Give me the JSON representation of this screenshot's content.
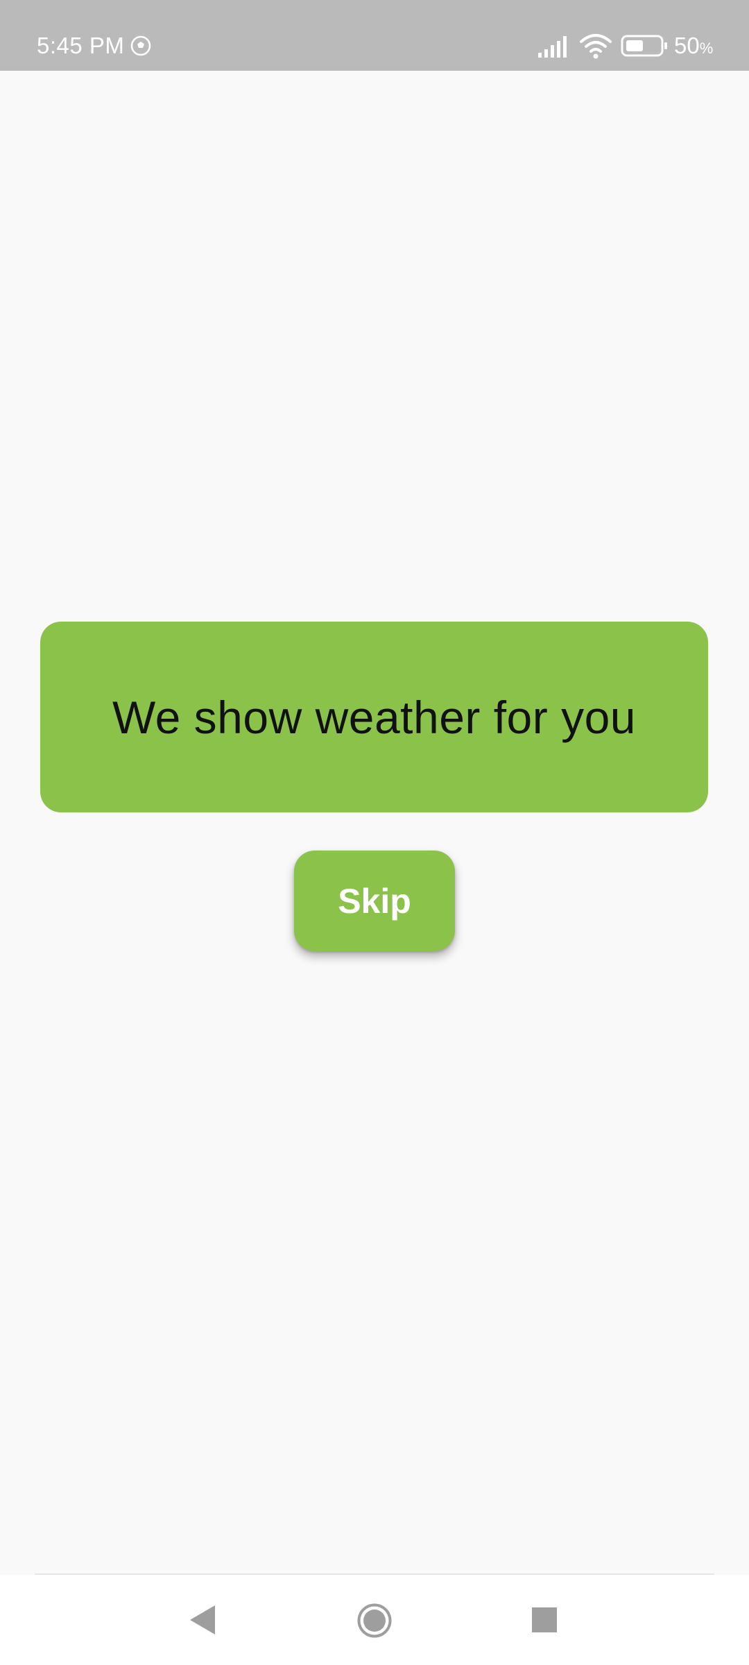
{
  "status_bar": {
    "time": "5:45 PM",
    "battery_level": "50",
    "battery_unit": "%",
    "icons": [
      "soccer-ball-icon",
      "signal-icon",
      "wifi-icon",
      "battery-icon"
    ]
  },
  "main": {
    "message": "We show weather for you",
    "skip_label": "Skip"
  },
  "nav_bar": {
    "icons": [
      "back-icon",
      "home-icon",
      "recents-icon"
    ]
  },
  "colors": {
    "accent": "#8bc34a",
    "status_bar_bg": "#bababa",
    "background": "#f9f9f9"
  }
}
